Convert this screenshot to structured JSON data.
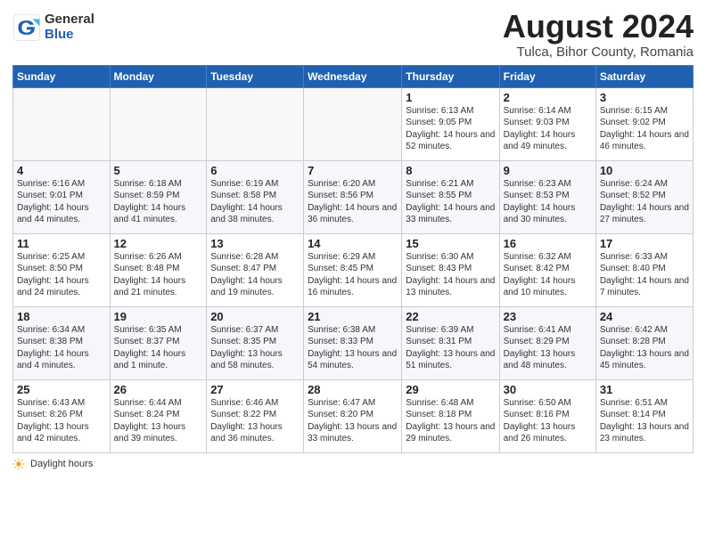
{
  "header": {
    "logo_general": "General",
    "logo_blue": "Blue",
    "month_year": "August 2024",
    "location": "Tulca, Bihor County, Romania"
  },
  "days_of_week": [
    "Sunday",
    "Monday",
    "Tuesday",
    "Wednesday",
    "Thursday",
    "Friday",
    "Saturday"
  ],
  "weeks": [
    [
      {
        "day": "",
        "sunrise": "",
        "sunset": "",
        "daylight": ""
      },
      {
        "day": "",
        "sunrise": "",
        "sunset": "",
        "daylight": ""
      },
      {
        "day": "",
        "sunrise": "",
        "sunset": "",
        "daylight": ""
      },
      {
        "day": "",
        "sunrise": "",
        "sunset": "",
        "daylight": ""
      },
      {
        "day": "1",
        "sunrise": "Sunrise: 6:13 AM",
        "sunset": "Sunset: 9:05 PM",
        "daylight": "Daylight: 14 hours and 52 minutes."
      },
      {
        "day": "2",
        "sunrise": "Sunrise: 6:14 AM",
        "sunset": "Sunset: 9:03 PM",
        "daylight": "Daylight: 14 hours and 49 minutes."
      },
      {
        "day": "3",
        "sunrise": "Sunrise: 6:15 AM",
        "sunset": "Sunset: 9:02 PM",
        "daylight": "Daylight: 14 hours and 46 minutes."
      }
    ],
    [
      {
        "day": "4",
        "sunrise": "Sunrise: 6:16 AM",
        "sunset": "Sunset: 9:01 PM",
        "daylight": "Daylight: 14 hours and 44 minutes."
      },
      {
        "day": "5",
        "sunrise": "Sunrise: 6:18 AM",
        "sunset": "Sunset: 8:59 PM",
        "daylight": "Daylight: 14 hours and 41 minutes."
      },
      {
        "day": "6",
        "sunrise": "Sunrise: 6:19 AM",
        "sunset": "Sunset: 8:58 PM",
        "daylight": "Daylight: 14 hours and 38 minutes."
      },
      {
        "day": "7",
        "sunrise": "Sunrise: 6:20 AM",
        "sunset": "Sunset: 8:56 PM",
        "daylight": "Daylight: 14 hours and 36 minutes."
      },
      {
        "day": "8",
        "sunrise": "Sunrise: 6:21 AM",
        "sunset": "Sunset: 8:55 PM",
        "daylight": "Daylight: 14 hours and 33 minutes."
      },
      {
        "day": "9",
        "sunrise": "Sunrise: 6:23 AM",
        "sunset": "Sunset: 8:53 PM",
        "daylight": "Daylight: 14 hours and 30 minutes."
      },
      {
        "day": "10",
        "sunrise": "Sunrise: 6:24 AM",
        "sunset": "Sunset: 8:52 PM",
        "daylight": "Daylight: 14 hours and 27 minutes."
      }
    ],
    [
      {
        "day": "11",
        "sunrise": "Sunrise: 6:25 AM",
        "sunset": "Sunset: 8:50 PM",
        "daylight": "Daylight: 14 hours and 24 minutes."
      },
      {
        "day": "12",
        "sunrise": "Sunrise: 6:26 AM",
        "sunset": "Sunset: 8:48 PM",
        "daylight": "Daylight: 14 hours and 21 minutes."
      },
      {
        "day": "13",
        "sunrise": "Sunrise: 6:28 AM",
        "sunset": "Sunset: 8:47 PM",
        "daylight": "Daylight: 14 hours and 19 minutes."
      },
      {
        "day": "14",
        "sunrise": "Sunrise: 6:29 AM",
        "sunset": "Sunset: 8:45 PM",
        "daylight": "Daylight: 14 hours and 16 minutes."
      },
      {
        "day": "15",
        "sunrise": "Sunrise: 6:30 AM",
        "sunset": "Sunset: 8:43 PM",
        "daylight": "Daylight: 14 hours and 13 minutes."
      },
      {
        "day": "16",
        "sunrise": "Sunrise: 6:32 AM",
        "sunset": "Sunset: 8:42 PM",
        "daylight": "Daylight: 14 hours and 10 minutes."
      },
      {
        "day": "17",
        "sunrise": "Sunrise: 6:33 AM",
        "sunset": "Sunset: 8:40 PM",
        "daylight": "Daylight: 14 hours and 7 minutes."
      }
    ],
    [
      {
        "day": "18",
        "sunrise": "Sunrise: 6:34 AM",
        "sunset": "Sunset: 8:38 PM",
        "daylight": "Daylight: 14 hours and 4 minutes."
      },
      {
        "day": "19",
        "sunrise": "Sunrise: 6:35 AM",
        "sunset": "Sunset: 8:37 PM",
        "daylight": "Daylight: 14 hours and 1 minute."
      },
      {
        "day": "20",
        "sunrise": "Sunrise: 6:37 AM",
        "sunset": "Sunset: 8:35 PM",
        "daylight": "Daylight: 13 hours and 58 minutes."
      },
      {
        "day": "21",
        "sunrise": "Sunrise: 6:38 AM",
        "sunset": "Sunset: 8:33 PM",
        "daylight": "Daylight: 13 hours and 54 minutes."
      },
      {
        "day": "22",
        "sunrise": "Sunrise: 6:39 AM",
        "sunset": "Sunset: 8:31 PM",
        "daylight": "Daylight: 13 hours and 51 minutes."
      },
      {
        "day": "23",
        "sunrise": "Sunrise: 6:41 AM",
        "sunset": "Sunset: 8:29 PM",
        "daylight": "Daylight: 13 hours and 48 minutes."
      },
      {
        "day": "24",
        "sunrise": "Sunrise: 6:42 AM",
        "sunset": "Sunset: 8:28 PM",
        "daylight": "Daylight: 13 hours and 45 minutes."
      }
    ],
    [
      {
        "day": "25",
        "sunrise": "Sunrise: 6:43 AM",
        "sunset": "Sunset: 8:26 PM",
        "daylight": "Daylight: 13 hours and 42 minutes."
      },
      {
        "day": "26",
        "sunrise": "Sunrise: 6:44 AM",
        "sunset": "Sunset: 8:24 PM",
        "daylight": "Daylight: 13 hours and 39 minutes."
      },
      {
        "day": "27",
        "sunrise": "Sunrise: 6:46 AM",
        "sunset": "Sunset: 8:22 PM",
        "daylight": "Daylight: 13 hours and 36 minutes."
      },
      {
        "day": "28",
        "sunrise": "Sunrise: 6:47 AM",
        "sunset": "Sunset: 8:20 PM",
        "daylight": "Daylight: 13 hours and 33 minutes."
      },
      {
        "day": "29",
        "sunrise": "Sunrise: 6:48 AM",
        "sunset": "Sunset: 8:18 PM",
        "daylight": "Daylight: 13 hours and 29 minutes."
      },
      {
        "day": "30",
        "sunrise": "Sunrise: 6:50 AM",
        "sunset": "Sunset: 8:16 PM",
        "daylight": "Daylight: 13 hours and 26 minutes."
      },
      {
        "day": "31",
        "sunrise": "Sunrise: 6:51 AM",
        "sunset": "Sunset: 8:14 PM",
        "daylight": "Daylight: 13 hours and 23 minutes."
      }
    ]
  ],
  "footer": {
    "daylight_label": "Daylight hours"
  }
}
